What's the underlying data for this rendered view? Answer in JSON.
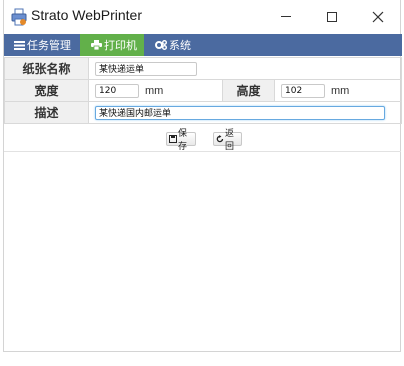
{
  "window": {
    "title": "Strato WebPrinter",
    "icon": "printer-app-icon",
    "controls": [
      "minimize-icon",
      "maximize-icon",
      "close-icon"
    ]
  },
  "menu": {
    "items": [
      {
        "label": "任务管理",
        "icon": "task-list-icon",
        "active": false
      },
      {
        "label": "打印机",
        "icon": "printer-icon",
        "active": true
      },
      {
        "label": "系统",
        "icon": "gears-icon",
        "active": false
      }
    ],
    "bar_color": "#4b6aa0",
    "active_color": "#62b04a"
  },
  "form": {
    "paper_name": {
      "label": "纸张名称",
      "value": "某快递运单"
    },
    "width": {
      "label": "宽度",
      "value": "120",
      "unit": "mm"
    },
    "height": {
      "label": "高度",
      "value": "102",
      "unit": "mm"
    },
    "description": {
      "label": "描述",
      "value": "某快递国内邮运单"
    }
  },
  "buttons": {
    "save": {
      "label": "保存",
      "icon": "save-icon"
    },
    "back": {
      "label": "返回",
      "icon": "return-icon"
    }
  }
}
